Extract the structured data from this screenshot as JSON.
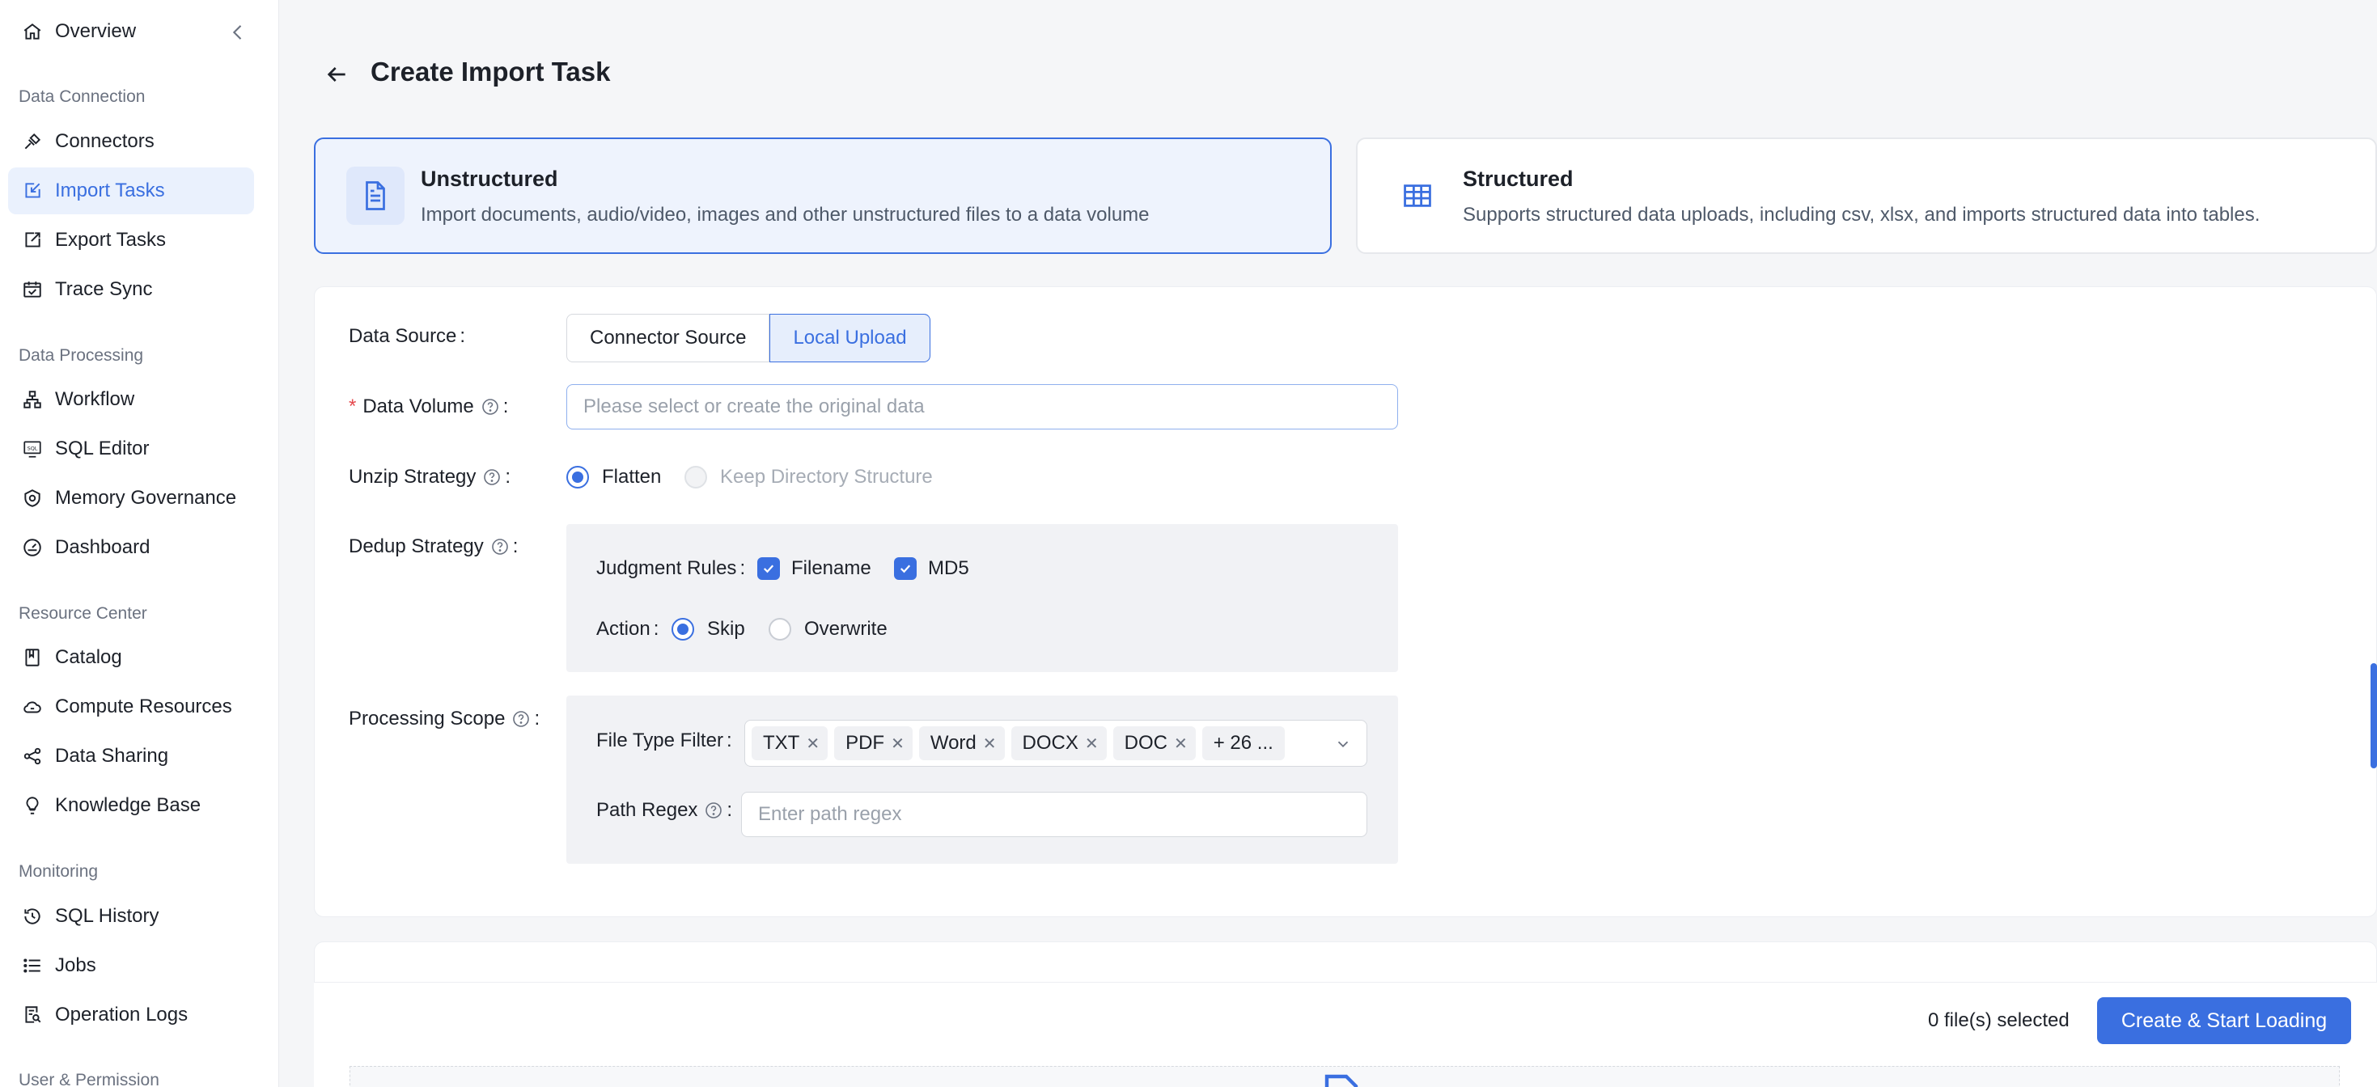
{
  "sidebar": {
    "overview": "Overview",
    "groups": {
      "data_connection": "Data Connection",
      "data_processing": "Data Processing",
      "resource_center": "Resource Center",
      "monitoring": "Monitoring",
      "user_permission": "User & Permission"
    },
    "items": {
      "connectors": "Connectors",
      "import_tasks": "Import Tasks",
      "export_tasks": "Export Tasks",
      "trace_sync": "Trace Sync",
      "workflow": "Workflow",
      "sql_editor": "SQL Editor",
      "memory_governance": "Memory Governance",
      "dashboard": "Dashboard",
      "catalog": "Catalog",
      "compute_resources": "Compute Resources",
      "data_sharing": "Data Sharing",
      "knowledge_base": "Knowledge Base",
      "sql_history": "SQL History",
      "jobs": "Jobs",
      "operation_logs": "Operation Logs"
    },
    "active": "import_tasks"
  },
  "page": {
    "title": "Create Import Task"
  },
  "type_cards": {
    "unstructured": {
      "title": "Unstructured",
      "desc": "Import documents, audio/video, images and other unstructured files to a data volume"
    },
    "structured": {
      "title": "Structured",
      "desc": "Supports structured data uploads, including csv, xlsx, and imports structured data into tables."
    }
  },
  "form": {
    "data_source": {
      "label": "Data Source",
      "options": [
        "Connector Source",
        "Local Upload"
      ],
      "selected": "Local Upload"
    },
    "data_volume": {
      "label": "Data Volume",
      "placeholder": "Please select or create the original data"
    },
    "unzip_strategy": {
      "label": "Unzip Strategy",
      "options": [
        "Flatten",
        "Keep Directory Structure"
      ],
      "selected": "Flatten"
    },
    "dedup_strategy": {
      "label": "Dedup Strategy",
      "judgment_label": "Judgment Rules",
      "judgment_options": [
        "Filename",
        "MD5"
      ],
      "action_label": "Action",
      "action_options": [
        "Skip",
        "Overwrite"
      ],
      "action_selected": "Skip"
    },
    "processing_scope": {
      "label": "Processing Scope",
      "file_type_label": "File Type Filter",
      "file_types": [
        "TXT",
        "PDF",
        "Word",
        "DOCX",
        "DOC"
      ],
      "more_count": "+ 26 ...",
      "path_regex_label": "Path Regex",
      "path_regex_placeholder": "Enter path regex"
    }
  },
  "colon": ":",
  "footer": {
    "files_selected": "0 file(s) selected",
    "submit_label": "Create & Start Loading"
  },
  "colors": {
    "accent": "#3a6fe0",
    "required": "#e5484d"
  }
}
